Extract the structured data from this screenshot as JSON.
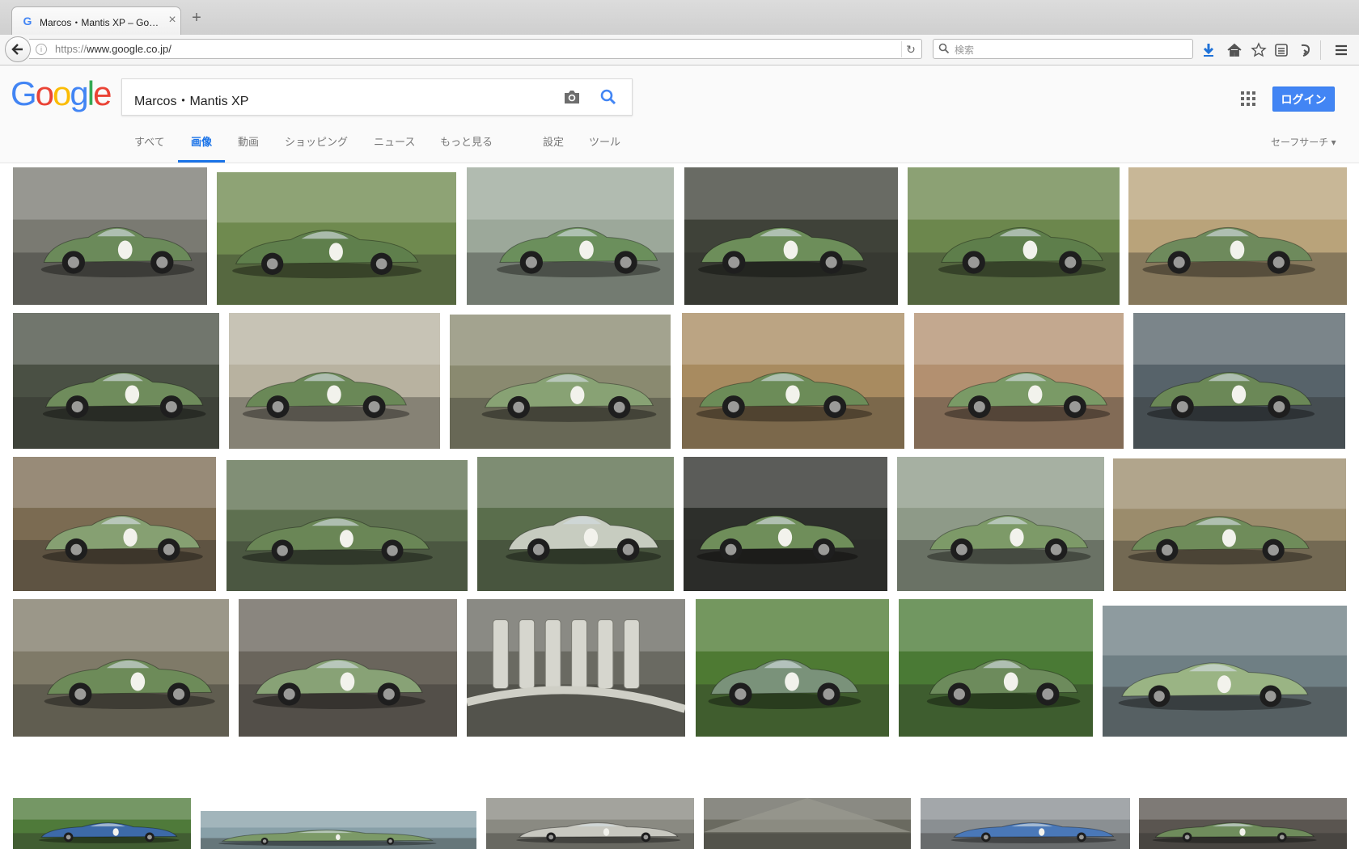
{
  "browser": {
    "tab_title": "Marcos・Mantis XP – Goo…",
    "tab_favicon": "G",
    "tab_close": "×",
    "new_tab": "+",
    "url_scheme": "https://",
    "url_host": "www.google.co.jp/",
    "search_placeholder": "検索",
    "icons": [
      "back-arrow-icon",
      "info-icon",
      "reload-icon",
      "search-icon",
      "download-icon",
      "home-icon",
      "bookmark-star-icon",
      "library-icon",
      "pocket-icon",
      "hamburger-menu-icon"
    ]
  },
  "google": {
    "logo_letters": [
      "G",
      "o",
      "o",
      "g",
      "l",
      "e"
    ],
    "logo_colors": [
      "#4285f4",
      "#ea4335",
      "#fbbc05",
      "#4285f4",
      "#34a853",
      "#ea4335"
    ],
    "query": "Marcos・Mantis XP",
    "login_label": "ログイン",
    "tabs": {
      "all": "すべて",
      "images": "画像",
      "videos": "動画",
      "shopping": "ショッピング",
      "news": "ニュース",
      "more": "もっと見る",
      "settings": "設定",
      "tools": "ツール"
    },
    "safesearch": "セーフサーチ ▾",
    "accent": "#1a73e8",
    "button_color": "#4285f4"
  },
  "results": {
    "rows": [
      [
        {
          "scene": "car-rear-track",
          "bg": "#7a7a72",
          "car": "#6b8a5a"
        },
        {
          "scene": "car-side-blur",
          "bg": "#6f8a4f",
          "car": "#5f7f4c"
        },
        {
          "scene": "car-front-crowd",
          "bg": "#9ca89a",
          "car": "#6b8f5c"
        },
        {
          "scene": "car-rear-dark",
          "bg": "#3f4239",
          "car": "#6d8e5a"
        },
        {
          "scene": "car-side-blur",
          "bg": "#6c874d",
          "car": "#5e7e4b"
        },
        {
          "scene": "car-side-hay",
          "bg": "#b9a37a",
          "car": "#6e8a5c"
        }
      ],
      [
        {
          "scene": "car-closeup",
          "bg": "#4a5044",
          "car": "#6f8c5c"
        },
        {
          "scene": "car-side-event",
          "bg": "#b8b2a0",
          "car": "#6a8857"
        },
        {
          "scene": "car-front-grass",
          "bg": "#8a8a70",
          "car": "#88a274"
        },
        {
          "scene": "car-side-fence",
          "bg": "#a88b60",
          "car": "#6c8c58"
        },
        {
          "scene": "car-front-crowd",
          "bg": "#b39070",
          "car": "#7a9a66"
        },
        {
          "scene": "car-side-sky",
          "bg": "#57636a",
          "car": "#6b8857"
        }
      ],
      [
        {
          "scene": "car-front-hay",
          "bg": "#7b6b52",
          "car": "#86a072"
        },
        {
          "scene": "car-open-doors",
          "bg": "#5e7050",
          "car": "#6a8656"
        },
        {
          "scene": "car-rear-finish",
          "bg": "#5a6e4c",
          "car": "#c7ccc0"
        },
        {
          "scene": "car-top-dark",
          "bg": "#2d2f2b",
          "car": "#6f8e5a"
        },
        {
          "scene": "car-front-start",
          "bg": "#8e9a88",
          "car": "#7d9a68"
        },
        {
          "scene": "car-front-start",
          "bg": "#9b8c6c",
          "car": "#6f8c5a"
        }
      ],
      [
        {
          "scene": "car-side-nissan",
          "bg": "#7f7a68",
          "car": "#6d8b59"
        },
        {
          "scene": "car-paddock",
          "bg": "#6a655c",
          "car": "#88a276"
        },
        {
          "scene": "engine",
          "bg": "#6a6a62",
          "car": "#b9b9b0"
        },
        {
          "scene": "car-lawn",
          "bg": "#4e7a33",
          "car": "#7a927a"
        },
        {
          "scene": "car-lawn-people",
          "bg": "#4a7a35",
          "car": "#6d8b5c"
        },
        {
          "scene": "car-front-sky",
          "bg": "#6f7f84",
          "car": "#9ab484"
        }
      ],
      [
        {
          "scene": "cars-park",
          "bg": "#4f7a3a",
          "car": "#3d6aa8"
        },
        {
          "scene": "car-sky-cropped",
          "bg": "#88a0a8",
          "car": "#7c9a68"
        },
        {
          "scene": "car-workshop",
          "bg": "#8a8a82",
          "car": "#c8c8c0"
        },
        {
          "scene": "tent",
          "bg": "#6a6a60",
          "car": "#7f8f6a"
        },
        {
          "scene": "crowd-car",
          "bg": "#8a8f92",
          "car": "#4a78b8"
        },
        {
          "scene": "car-closeup",
          "bg": "#5a5550",
          "car": "#6f8c5c"
        }
      ]
    ]
  }
}
